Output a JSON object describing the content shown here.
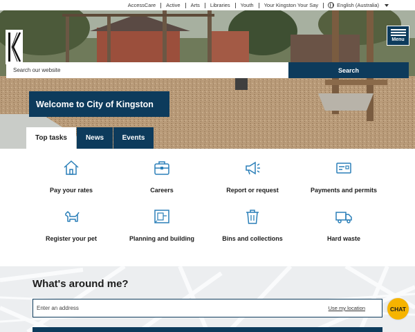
{
  "utility_nav": {
    "links": [
      "AccessCare",
      "Active",
      "Arts",
      "Libraries",
      "Youth",
      "Your Kingston Your Say"
    ],
    "language": "English (Australia)"
  },
  "header": {
    "menu_label": "Menu"
  },
  "search": {
    "placeholder": "Search our website",
    "button_label": "Search"
  },
  "hero": {
    "welcome": "Welcome to City of Kingston"
  },
  "tabs": [
    {
      "label": "Top tasks",
      "active": true
    },
    {
      "label": "News",
      "active": false
    },
    {
      "label": "Events",
      "active": false
    }
  ],
  "tasks": [
    {
      "label": "Pay your rates",
      "icon": "house-icon"
    },
    {
      "label": "Careers",
      "icon": "briefcase-icon"
    },
    {
      "label": "Report or request",
      "icon": "megaphone-icon"
    },
    {
      "label": "Payments and permits",
      "icon": "card-icon"
    },
    {
      "label": "Register your pet",
      "icon": "dog-icon"
    },
    {
      "label": "Planning and building",
      "icon": "blueprint-icon"
    },
    {
      "label": "Bins and collections",
      "icon": "bin-icon"
    },
    {
      "label": "Hard waste",
      "icon": "truck-icon"
    }
  ],
  "around": {
    "title": "What's around me?",
    "address_placeholder": "Enter an address",
    "use_location": "Use my location"
  },
  "chat": {
    "label": "CHAT"
  },
  "colors": {
    "brand_navy": "#0d3b5c",
    "icon_blue": "#2a7fb8",
    "chat_yellow": "#f6b400"
  }
}
